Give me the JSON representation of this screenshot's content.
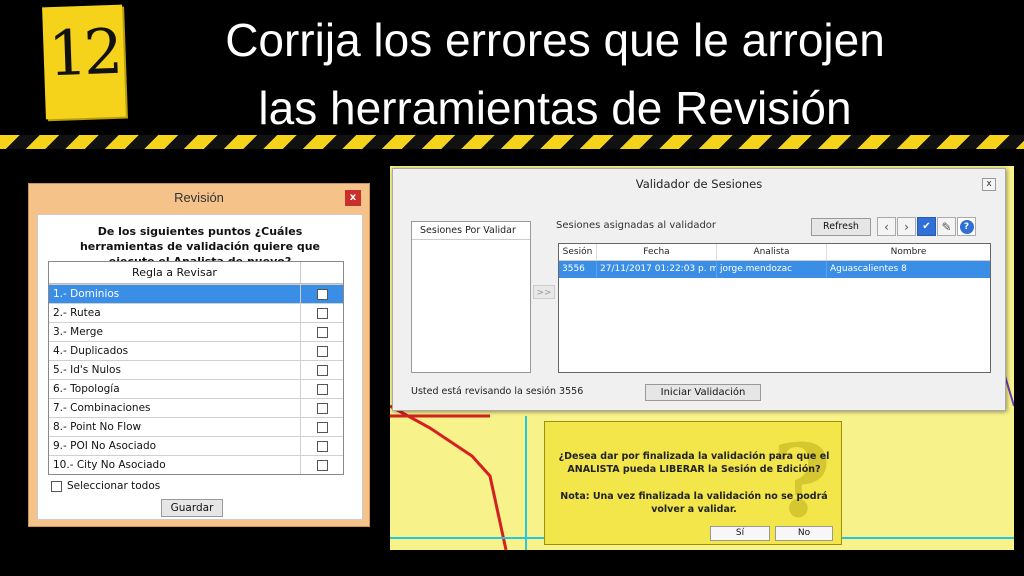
{
  "header": {
    "step_number": "12",
    "title_line1": "Corrija los errores que le arrojen",
    "title_line2": "las herramientas de Revisión"
  },
  "revision_window": {
    "title": "Revisión",
    "close_label": "x",
    "question": "De los siguientes puntos ¿Cuáles herramientas de validación quiere que ejecute el Analista de nuevo?",
    "column_header": "Regla a Revisar",
    "rules": [
      {
        "label": "1.- Dominios",
        "selected": true
      },
      {
        "label": "2.- Rutea"
      },
      {
        "label": "3.- Merge"
      },
      {
        "label": "4.- Duplicados"
      },
      {
        "label": "5.- Id's Nulos"
      },
      {
        "label": "6.- Topología"
      },
      {
        "label": "7.- Combinaciones"
      },
      {
        "label": "8.- Point No Flow"
      },
      {
        "label": "9.- POI No Asociado"
      },
      {
        "label": "10.- City No Asociado"
      }
    ],
    "select_all_label": "Seleccionar todos",
    "save_label": "Guardar"
  },
  "validator_window": {
    "title": "Validador de Sesiones",
    "close_label": "x",
    "pending_header": "Sesiones Por Validar",
    "move_button": ">>",
    "assigned_label": "Sesiones asignadas al validador",
    "refresh_label": "Refresh",
    "columns": [
      "Sesión",
      "Fecha",
      "Analista",
      "Nombre"
    ],
    "rows": [
      [
        "3556",
        "27/11/2017 01:22:03 p. m.",
        "jorge.mendozac",
        "Aguascalientes 8"
      ]
    ],
    "reviewing_text": "Usted está revisando la sesión 3556",
    "start_button": "Iniciar Validación",
    "tool_icons": [
      "arrow-left-icon",
      "arrow-right-icon",
      "check-icon",
      "edit-icon",
      "help-icon"
    ]
  },
  "confirm_dialog": {
    "question": "¿Desea dar por finalizada la validación para que el ANALISTA pueda LIBERAR la Sesión de Edición?",
    "note": "Nota: Una vez finalizada la validación no se podrá volver a validar.",
    "yes_label": "Sí",
    "no_label": "No"
  },
  "colors": {
    "badge_yellow": "#f5d31a",
    "selection_blue": "#3a8ee6",
    "map_yellow": "#f7f28a",
    "map_road_red": "#d42020",
    "map_line_cyan": "#22c7e0"
  }
}
